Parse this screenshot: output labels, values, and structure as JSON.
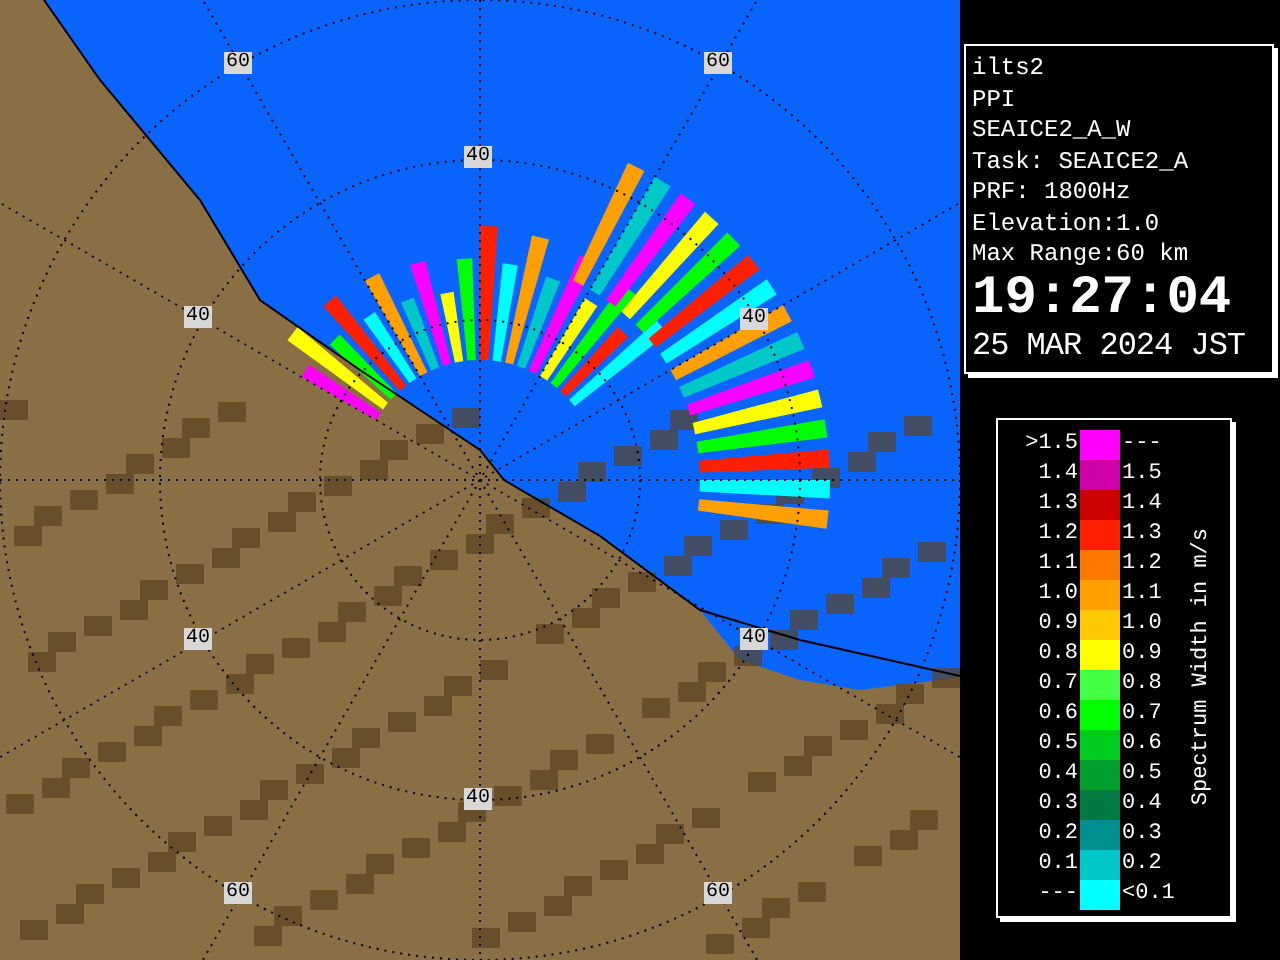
{
  "map": {
    "range_labels": [
      {
        "text": "60"
      },
      {
        "text": "60"
      },
      {
        "text": "40"
      },
      {
        "text": "40"
      },
      {
        "text": "40"
      },
      {
        "text": "40"
      },
      {
        "text": "40"
      },
      {
        "text": "40"
      },
      {
        "text": "60"
      },
      {
        "text": "60"
      }
    ]
  },
  "station": {
    "lines": [
      "ilts2",
      "PPI",
      "SEAICE2_A_W",
      "Task: SEAICE2_A",
      "PRF: 1800Hz",
      "Elevation:1.0",
      "Max Range:60 km"
    ],
    "time": "19:27:04",
    "date": "25 MAR 2024 JST"
  },
  "legend": {
    "title": "Spectrum Width in m/s",
    "rows": [
      {
        "lower": ">1.5",
        "upper": "---",
        "color": "#ff00ff"
      },
      {
        "lower": "1.4",
        "upper": "1.5",
        "color": "#d000a8"
      },
      {
        "lower": "1.3",
        "upper": "1.4",
        "color": "#cc0000"
      },
      {
        "lower": "1.2",
        "upper": "1.3",
        "color": "#ff2000"
      },
      {
        "lower": "1.1",
        "upper": "1.2",
        "color": "#ff7800"
      },
      {
        "lower": "1.0",
        "upper": "1.1",
        "color": "#ffa000"
      },
      {
        "lower": "0.9",
        "upper": "1.0",
        "color": "#ffc800"
      },
      {
        "lower": "0.8",
        "upper": "0.9",
        "color": "#ffff00"
      },
      {
        "lower": "0.7",
        "upper": "0.8",
        "color": "#44ff44"
      },
      {
        "lower": "0.6",
        "upper": "0.7",
        "color": "#00ff00"
      },
      {
        "lower": "0.5",
        "upper": "0.6",
        "color": "#00cc20"
      },
      {
        "lower": "0.4",
        "upper": "0.5",
        "color": "#00a030"
      },
      {
        "lower": "0.3",
        "upper": "0.4",
        "color": "#007a40"
      },
      {
        "lower": "0.2",
        "upper": "0.3",
        "color": "#009090"
      },
      {
        "lower": "0.1",
        "upper": "0.2",
        "color": "#00c8c8"
      },
      {
        "lower": "---",
        "upper": "<0.1",
        "color": "#00ffff"
      }
    ]
  }
}
